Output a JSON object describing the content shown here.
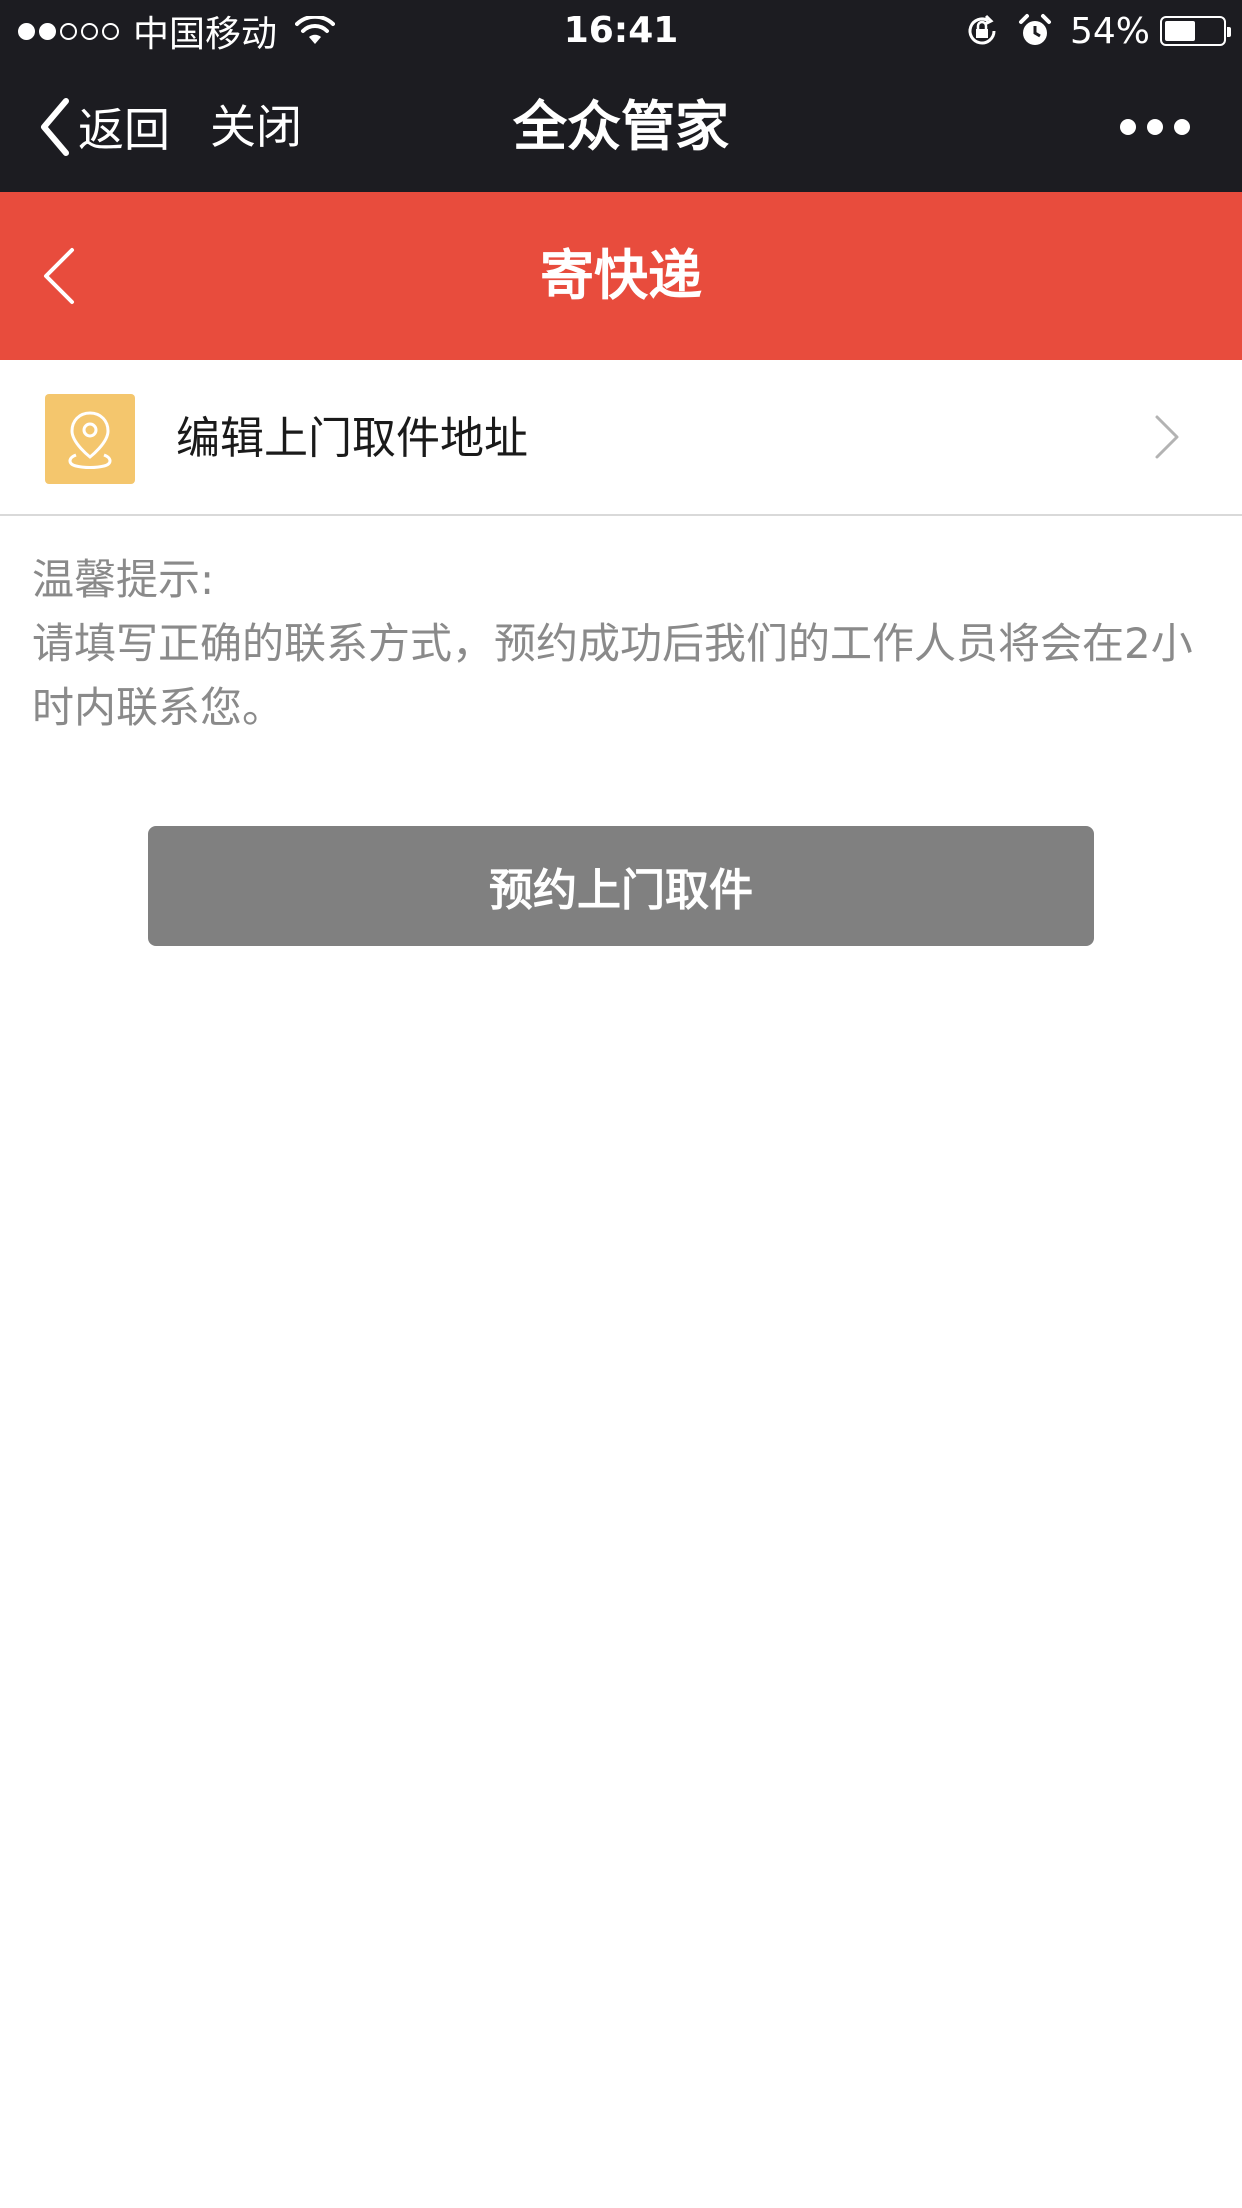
{
  "status_bar": {
    "carrier": "中国移动",
    "time": "16:41",
    "battery_percent": "54%",
    "battery_level": 0.54,
    "signal_strength": 2,
    "signal_total": 5
  },
  "nav": {
    "back_label": "返回",
    "close_label": "关闭",
    "title": "全众管家"
  },
  "header": {
    "title": "寄快递",
    "color": "#e84c3d"
  },
  "address": {
    "label": "编辑上门取件地址",
    "icon": "location-pin-icon",
    "icon_color": "#f4c66d"
  },
  "tip": {
    "heading": "温馨提示:",
    "body": "请填写正确的联系方式，预约成功后我们的工作人员将会在2小时内联系您。"
  },
  "action": {
    "button_label": "预约上门取件",
    "button_color": "#808080"
  }
}
